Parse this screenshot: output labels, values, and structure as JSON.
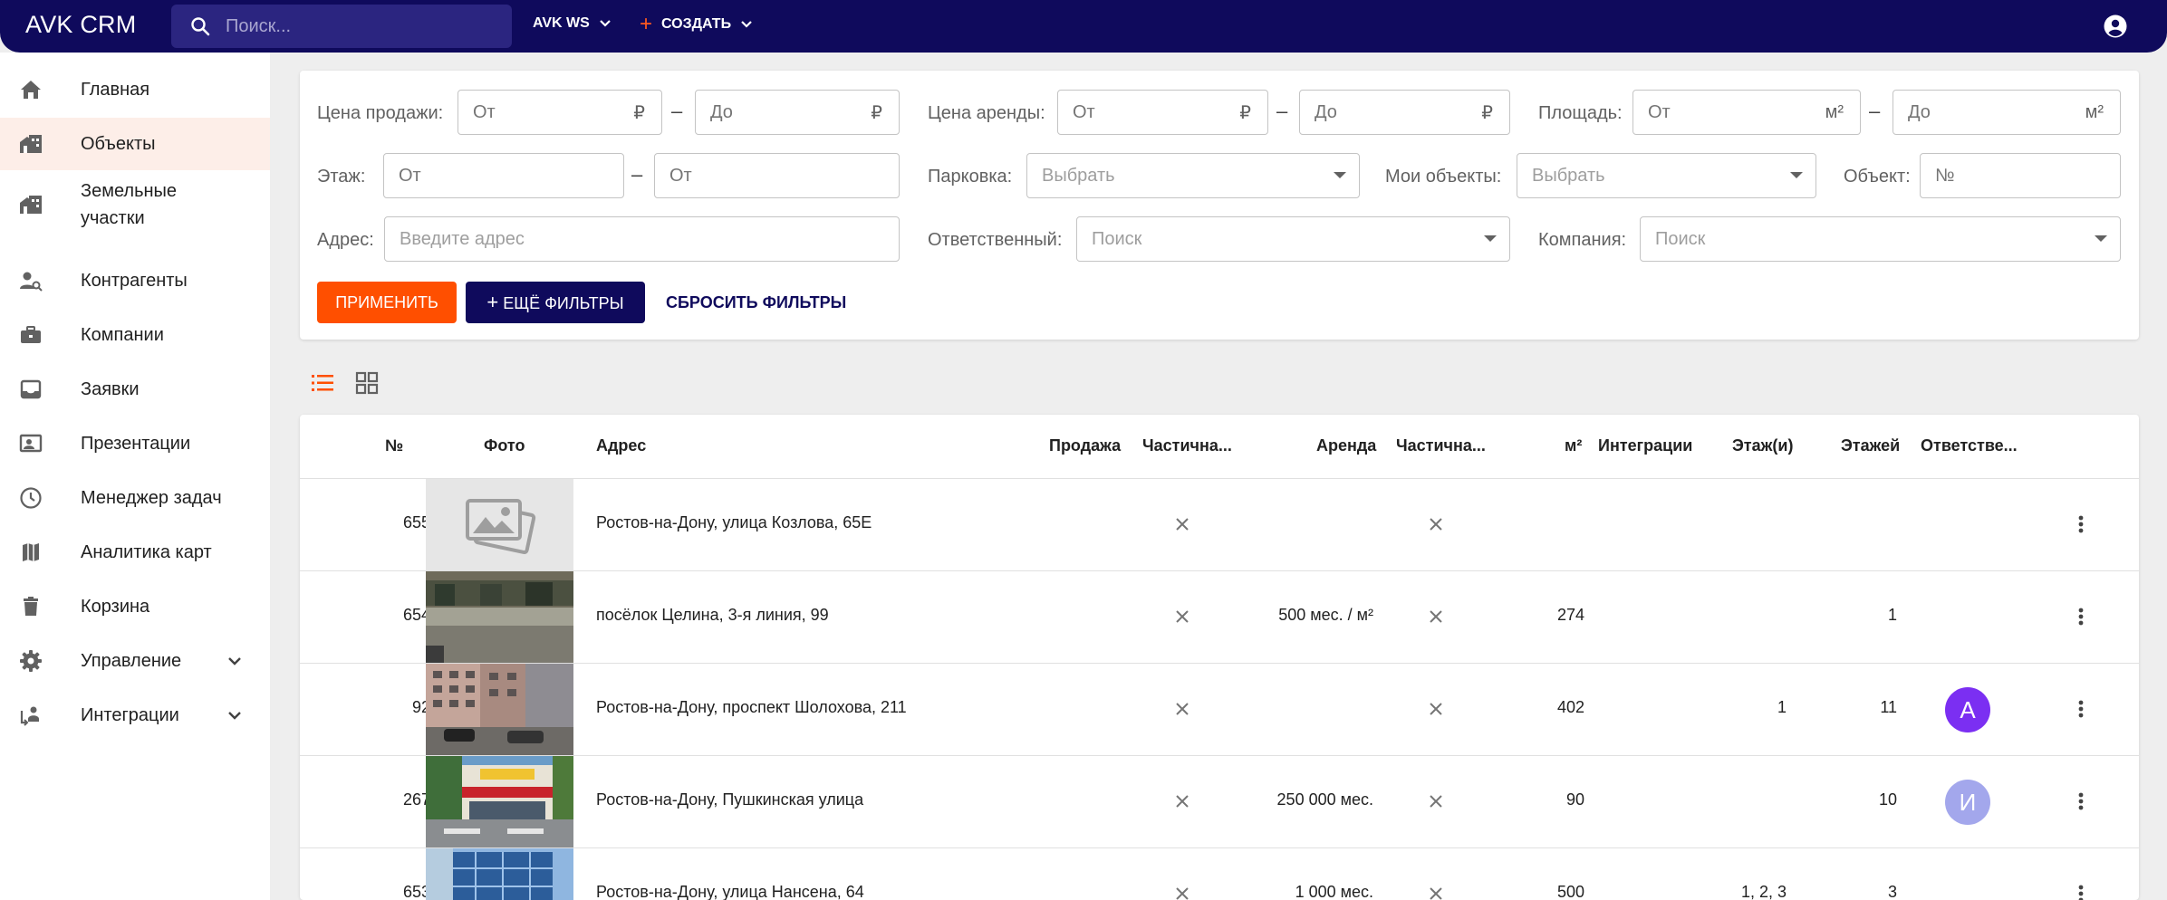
{
  "app": {
    "title": "AVK CRM"
  },
  "search": {
    "placeholder": "Поиск..."
  },
  "topmenu": {
    "workspace": "AVK WS",
    "create": "СОЗДАТЬ"
  },
  "sidebar": {
    "items": [
      {
        "label": "Главная",
        "icon": "home-icon"
      },
      {
        "label": "Объекты",
        "icon": "buildings-icon",
        "active": true
      },
      {
        "label": "Земельные участки",
        "icon": "land-icon"
      },
      {
        "label": "Контрагенты",
        "icon": "person-search-icon"
      },
      {
        "label": "Компании",
        "icon": "briefcase-icon"
      },
      {
        "label": "Заявки",
        "icon": "inbox-icon"
      },
      {
        "label": "Презентации",
        "icon": "presentation-icon"
      },
      {
        "label": "Менеджер задач",
        "icon": "clock-icon"
      },
      {
        "label": "Аналитика карт",
        "icon": "map-icon"
      },
      {
        "label": "Корзина",
        "icon": "trash-icon"
      },
      {
        "label": "Управление",
        "icon": "gear-icon"
      },
      {
        "label": "Интеграции",
        "icon": "integrations-icon"
      }
    ]
  },
  "filters": {
    "sale_price": {
      "label": "Цена продажи:",
      "from": "От",
      "to": "До",
      "unit": "₽"
    },
    "rent_price": {
      "label": "Цена аренды:",
      "from": "От",
      "to": "До",
      "unit": "₽"
    },
    "area": {
      "label": "Площадь:",
      "from": "От",
      "to": "До",
      "unit": "м²"
    },
    "floor": {
      "label": "Этаж:",
      "from": "От",
      "to": "От"
    },
    "parking": {
      "label": "Парковка:",
      "placeholder": "Выбрать"
    },
    "my_objects": {
      "label": "Мои объекты:",
      "placeholder": "Выбрать"
    },
    "object": {
      "label": "Объект:",
      "placeholder": "№"
    },
    "address": {
      "label": "Адрес:",
      "placeholder": "Введите адрес"
    },
    "responsible": {
      "label": "Ответственный:",
      "placeholder": "Поиск"
    },
    "company": {
      "label": "Компания:",
      "placeholder": "Поиск"
    },
    "apply": "ПРИМЕНИТЬ",
    "more": "ЕЩЁ ФИЛЬТРЫ",
    "reset": "СБРОСИТЬ ФИЛЬТРЫ"
  },
  "table": {
    "headers": {
      "num": "№",
      "photo": "Фото",
      "address": "Адрес",
      "sale": "Продажа",
      "sale_partial": "Частична...",
      "rent": "Аренда",
      "rent_partial": "Частична...",
      "area": "м²",
      "integrations": "Интеграции",
      "floor": "Этаж(и)",
      "floors": "Этажей",
      "responsible": "Ответстве..."
    },
    "rows": [
      {
        "num": "655",
        "address": "Ростов-на-Дону, улица Козлова, 65Е",
        "sale": "",
        "rent": "",
        "area": "",
        "floor": "",
        "floors": "",
        "avatar": "",
        "avatar_color": "",
        "photo": "placeholder"
      },
      {
        "num": "654",
        "address": "посёлок Целина, 3-я линия, 99",
        "sale": "",
        "rent": "500 мес. / м²",
        "area": "274",
        "floor": "",
        "floors": "1",
        "avatar": "",
        "avatar_color": "",
        "photo": "street"
      },
      {
        "num": "92",
        "address": "Ростов-на-Дону, проспект Шолохова, 211",
        "sale": "",
        "rent": "",
        "area": "402",
        "floor": "1",
        "floors": "11",
        "avatar": "А",
        "avatar_color": "#7b2ff2",
        "photo": "building"
      },
      {
        "num": "267",
        "address": "Ростов-на-Дону, Пушкинская улица",
        "sale": "",
        "rent": "250 000 мес.",
        "area": "90",
        "floor": "",
        "floors": "10",
        "avatar": "И",
        "avatar_color": "#a3a7ec",
        "photo": "shop"
      },
      {
        "num": "653",
        "address": "Ростов-на-Дону, улица Нансена, 64",
        "sale": "",
        "rent": "1 000 мес.",
        "area": "500",
        "floor": "1, 2, 3",
        "floors": "3",
        "avatar": "",
        "avatar_color": "",
        "photo": "glass"
      }
    ]
  },
  "colors": {
    "primary": "#0f0a5c",
    "accent": "#ff4f00",
    "active_bg": "#fdeee8"
  }
}
